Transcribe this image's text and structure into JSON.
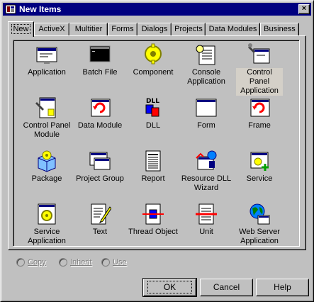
{
  "window": {
    "title": "New Items",
    "close_glyph": "×"
  },
  "tabs": [
    {
      "label": "New",
      "active": true
    },
    {
      "label": "ActiveX"
    },
    {
      "label": "Multitier"
    },
    {
      "label": "Forms"
    },
    {
      "label": "Dialogs"
    },
    {
      "label": "Projects"
    },
    {
      "label": "Data Modules"
    },
    {
      "label": "Business"
    }
  ],
  "items": [
    {
      "label": "Application",
      "icon": "application-icon"
    },
    {
      "label": "Batch File",
      "icon": "batch-file-icon"
    },
    {
      "label": "Component",
      "icon": "component-icon"
    },
    {
      "label": "Console Application",
      "icon": "console-application-icon"
    },
    {
      "label": "Control Panel Application",
      "icon": "control-panel-application-icon",
      "selected": true
    },
    {
      "label": "Control Panel Module",
      "icon": "control-panel-module-icon"
    },
    {
      "label": "Data Module",
      "icon": "data-module-icon"
    },
    {
      "label": "DLL",
      "icon": "dll-icon"
    },
    {
      "label": "Form",
      "icon": "form-icon"
    },
    {
      "label": "Frame",
      "icon": "frame-icon"
    },
    {
      "label": "Package",
      "icon": "package-icon"
    },
    {
      "label": "Project Group",
      "icon": "project-group-icon"
    },
    {
      "label": "Report",
      "icon": "report-icon"
    },
    {
      "label": "Resource DLL Wizard",
      "icon": "resource-dll-wizard-icon"
    },
    {
      "label": "Service",
      "icon": "service-icon"
    },
    {
      "label": "Service Application",
      "icon": "service-application-icon"
    },
    {
      "label": "Text",
      "icon": "text-icon"
    },
    {
      "label": "Thread Object",
      "icon": "thread-object-icon"
    },
    {
      "label": "Unit",
      "icon": "unit-icon"
    },
    {
      "label": "Web Server Application",
      "icon": "web-server-application-icon"
    }
  ],
  "options": [
    {
      "label": "Copy"
    },
    {
      "label": "Inherit"
    },
    {
      "label": "Use"
    }
  ],
  "buttons": {
    "ok": "OK",
    "cancel": "Cancel",
    "help": "Help"
  },
  "colors": {
    "titlebar": "#000080",
    "face": "#c0c0c0",
    "shadow": "#808080",
    "highlight": "#ffffff"
  }
}
